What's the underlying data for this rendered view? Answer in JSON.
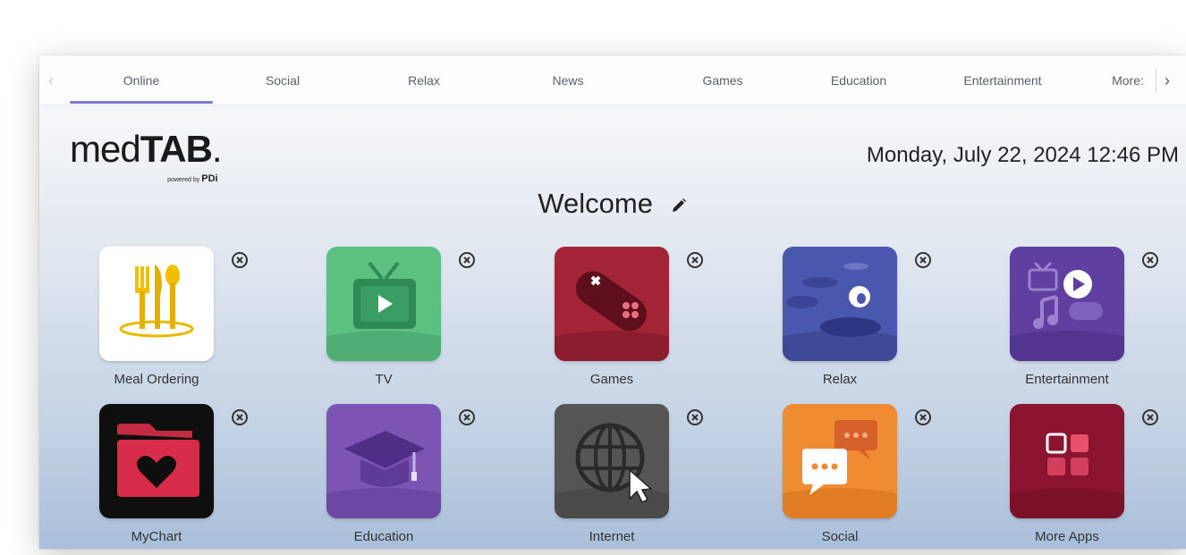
{
  "tabs": [
    {
      "label": "Online",
      "active": true
    },
    {
      "label": "Social",
      "active": false
    },
    {
      "label": "Relax",
      "active": false
    },
    {
      "label": "News",
      "active": false
    },
    {
      "label": "Games",
      "active": false
    },
    {
      "label": "Education",
      "active": false
    },
    {
      "label": "Entertainment",
      "active": false
    },
    {
      "label": "More:",
      "active": false
    }
  ],
  "nav": {
    "prev_icon": "chevron-left-icon",
    "next_icon": "chevron-right-icon"
  },
  "logo": {
    "brand_light": "med",
    "brand_bold": "TAB",
    "dot": ".",
    "powered_by": "powered by",
    "partner": "PDi"
  },
  "header": {
    "datetime": "Monday, July 22, 2024 12:46 PM",
    "welcome": "Welcome"
  },
  "apps": [
    {
      "label": "Meal Ordering",
      "icon": "cutlery-icon",
      "color": "#ffffff"
    },
    {
      "label": "TV",
      "icon": "tv-icon",
      "color": "#5cc081"
    },
    {
      "label": "Games",
      "icon": "gamepad-icon",
      "color": "#a32436"
    },
    {
      "label": "Relax",
      "icon": "relax-stones-icon",
      "color": "#4a57ae"
    },
    {
      "label": "Entertainment",
      "icon": "entertainment-icon",
      "color": "#5f3f9f"
    },
    {
      "label": "MyChart",
      "icon": "folder-heart-icon",
      "color": "#0f0f0f"
    },
    {
      "label": "Education",
      "icon": "graduation-cap-icon",
      "color": "#7c55b4"
    },
    {
      "label": "Internet",
      "icon": "globe-icon",
      "color": "#555555"
    },
    {
      "label": "Social",
      "icon": "chat-bubbles-icon",
      "color": "#ef8b30"
    },
    {
      "label": "More Apps",
      "icon": "apps-grid-icon",
      "color": "#8b1530"
    }
  ],
  "colors": {
    "accent": "#7b7ad0",
    "background_top": "#f5f6f8",
    "background_bottom": "#a9bfda"
  }
}
